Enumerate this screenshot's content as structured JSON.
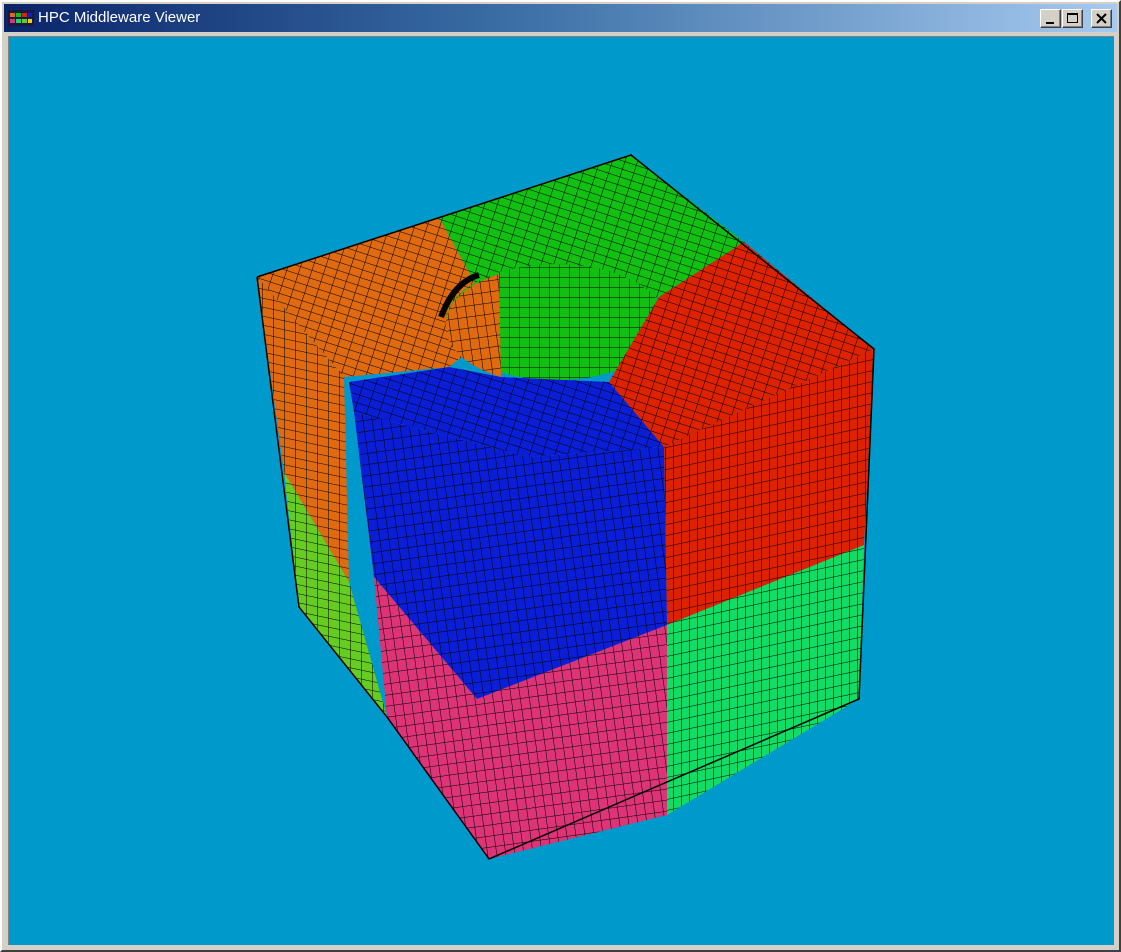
{
  "window": {
    "title": "HPC Middleware Viewer",
    "controls": {
      "minimize": "minimize",
      "maximize": "maximize",
      "close": "close"
    }
  },
  "viewport": {
    "background_color": "#0099cc",
    "mesh_line_color": "#000000",
    "partition_colors": {
      "orange": "#e06a10",
      "green": "#11c011",
      "red": "#dd2200",
      "blue": "#0a1ed6",
      "yellow_green": "#66cc22",
      "pink": "#dd3377",
      "teal_green": "#11dd66"
    }
  }
}
